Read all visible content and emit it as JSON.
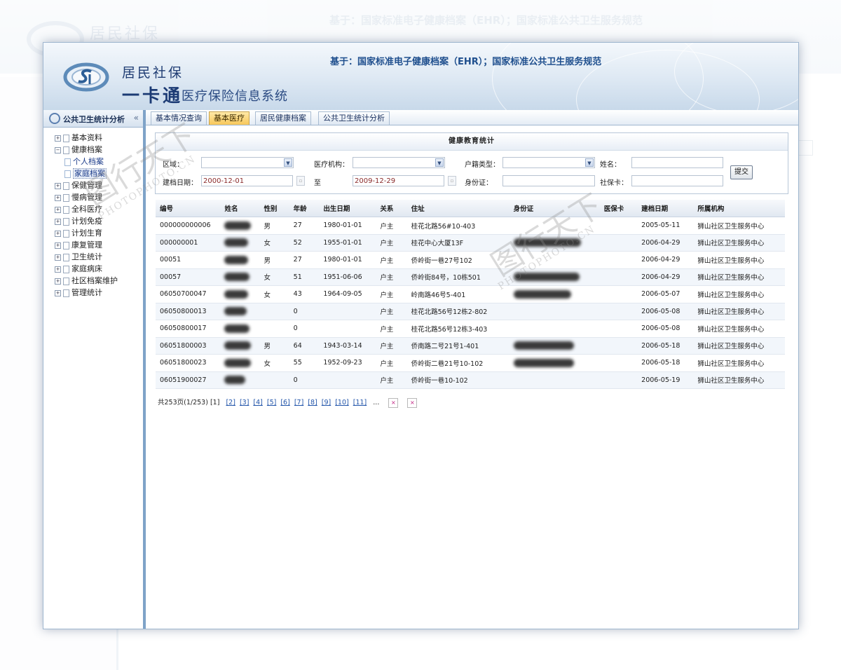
{
  "header": {
    "brand_line1": "居民社保",
    "brand_line2": "一卡通",
    "brand_line3": "医疗保险信息系统",
    "slogan": "基于：国家标准电子健康档案（EHR）；国家标准公共卫生服务规范"
  },
  "sidebar": {
    "title": "公共卫生统计分析",
    "collapse": "«",
    "items": [
      {
        "label": "基本资料",
        "sign": "+"
      },
      {
        "label": "健康档案",
        "sign": "−"
      },
      {
        "label": "个人档案",
        "child": true
      },
      {
        "label": "家庭档案",
        "child": true,
        "selected": true
      },
      {
        "label": "保健管理",
        "sign": "+"
      },
      {
        "label": "慢病管理",
        "sign": "+"
      },
      {
        "label": "全科医疗",
        "sign": "+"
      },
      {
        "label": "计划免疫",
        "sign": "+"
      },
      {
        "label": "计划生育",
        "sign": "+"
      },
      {
        "label": "康复管理",
        "sign": "+"
      },
      {
        "label": "卫生统计",
        "sign": "+"
      },
      {
        "label": "家庭病床",
        "sign": "+"
      },
      {
        "label": "社区档案维护",
        "sign": "+"
      },
      {
        "label": "管理统计",
        "sign": "+"
      }
    ]
  },
  "tabs": [
    {
      "label": "基本情况查询",
      "active": false
    },
    {
      "label": "基本医疗",
      "active": true
    },
    {
      "label": "居民健康档案",
      "active": false
    },
    {
      "label": "公共卫生统计分析",
      "active": false
    }
  ],
  "filter": {
    "title": "健康教育统计",
    "region_label": "区域：",
    "org_label": "医疗机构：",
    "hukou_label": "户籍类型：",
    "name_label": "姓名：",
    "date_label": "建档日期：",
    "date_from": "2000-12-01",
    "to_label": "至",
    "date_to": "2009-12-29",
    "id_label": "身份证：",
    "card_label": "社保卡：",
    "submit": "提交"
  },
  "table": {
    "headers": [
      "编号",
      "姓名",
      "性别",
      "年龄",
      "出生日期",
      "关系",
      "住址",
      "身份证",
      "医保卡",
      "建档日期",
      "所属机构"
    ],
    "rows": [
      {
        "id": "000000000006",
        "gender": "男",
        "age": "27",
        "birth": "1980-01-01",
        "rel": "户主",
        "addr": "桂花北路56#10-403",
        "created": "2005-05-11",
        "org": "狮山社区卫生服务中心"
      },
      {
        "id": "000000001",
        "gender": "女",
        "age": "52",
        "birth": "1955-01-01",
        "rel": "户主",
        "addr": "桂花中心大厦13F",
        "created": "2006-04-29",
        "org": "狮山社区卫生服务中心"
      },
      {
        "id": "00051",
        "gender": "男",
        "age": "27",
        "birth": "1980-01-01",
        "rel": "户主",
        "addr": "侨岭街一巷27号102",
        "created": "2006-04-29",
        "org": "狮山社区卫生服务中心"
      },
      {
        "id": "00057",
        "gender": "女",
        "age": "51",
        "birth": "1951-06-06",
        "rel": "户主",
        "addr": "侨岭街84号，10栋501",
        "created": "2006-04-29",
        "org": "狮山社区卫生服务中心"
      },
      {
        "id": "06050700047",
        "gender": "女",
        "age": "43",
        "birth": "1964-09-05",
        "rel": "户主",
        "addr": "岭南路46号5-401",
        "created": "2006-05-07",
        "org": "狮山社区卫生服务中心"
      },
      {
        "id": "06050800013",
        "gender": "",
        "age": "0",
        "birth": "",
        "rel": "户主",
        "addr": "桂花北路56号12栋2-802",
        "created": "2006-05-08",
        "org": "狮山社区卫生服务中心"
      },
      {
        "id": "06050800017",
        "gender": "",
        "age": "0",
        "birth": "",
        "rel": "户主",
        "addr": "桂花北路56号12栋3-403",
        "created": "2006-05-08",
        "org": "狮山社区卫生服务中心"
      },
      {
        "id": "06051800003",
        "gender": "男",
        "age": "64",
        "birth": "1943-03-14",
        "rel": "户主",
        "addr": "侨南路二号21号1-401",
        "created": "2006-05-18",
        "org": "狮山社区卫生服务中心"
      },
      {
        "id": "06051800023",
        "gender": "女",
        "age": "55",
        "birth": "1952-09-23",
        "rel": "户主",
        "addr": "侨岭街二巷21号10-102",
        "created": "2006-05-18",
        "org": "狮山社区卫生服务中心"
      },
      {
        "id": "06051900027",
        "gender": "",
        "age": "0",
        "birth": "",
        "rel": "户主",
        "addr": "侨岭街一巷10-102",
        "created": "2006-05-19",
        "org": "狮山社区卫生服务中心"
      }
    ]
  },
  "pager": {
    "summary": "共253页(1/253)",
    "current": "[1]",
    "links": [
      "[2]",
      "[3]",
      "[4]",
      "[5]",
      "[6]",
      "[7]",
      "[8]",
      "[9]",
      "[10]",
      "[11]"
    ],
    "ellipsis": "..."
  },
  "watermark": {
    "text": "图行天下",
    "sub": "PHOTOPHOTO.CN"
  }
}
